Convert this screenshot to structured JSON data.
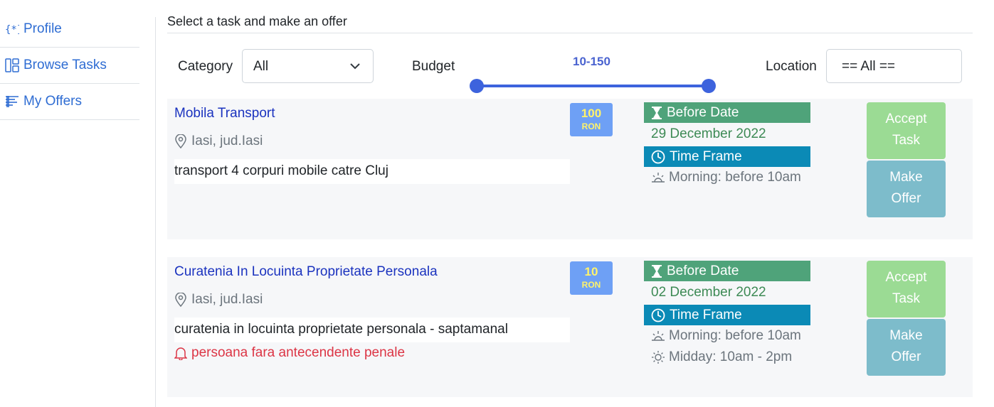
{
  "sidebar": {
    "items": [
      {
        "label": "Profile",
        "icon": "braces-asterisk-icon"
      },
      {
        "label": "Browse Tasks",
        "icon": "layout-icon"
      },
      {
        "label": "My Offers",
        "icon": "text-paragraph-icon"
      }
    ]
  },
  "main": {
    "heading": "Select a task and make an offer"
  },
  "filters": {
    "category_label": "Category",
    "category_value": "All",
    "budget_label": "Budget",
    "budget_range": "10-150",
    "location_label": "Location",
    "location_value": "== All =="
  },
  "tasks": [
    {
      "title": "Mobila Transport",
      "location": "Iasi, jud.Iasi",
      "description": "transport 4 corpuri mobile catre Cluj",
      "note": "",
      "price": "100",
      "currency": "RON",
      "before_date_label": "Before Date",
      "before_date": "29 December 2022",
      "time_frame_label": "Time Frame",
      "time_frames": [
        "Morning: before 10am"
      ],
      "accept_label_1": "Accept",
      "accept_label_2": "Task",
      "offer_label_1": "Make",
      "offer_label_2": "Offer"
    },
    {
      "title": "Curatenia In Locuinta Proprietate Personala",
      "location": "Iasi, jud.Iasi",
      "description": "curatenia in locuinta proprietate personala - saptamanal",
      "note": "persoana fara antecendente penale",
      "price": "10",
      "currency": "RON",
      "before_date_label": "Before Date",
      "before_date": "02 December 2022",
      "time_frame_label": "Time Frame",
      "time_frames": [
        "Morning: before 10am",
        "Midday: 10am - 2pm"
      ],
      "accept_label_1": "Accept",
      "accept_label_2": "Task",
      "offer_label_1": "Make",
      "offer_label_2": "Offer"
    }
  ],
  "colors": {
    "link": "#2f6dd3",
    "title": "#1b33bf",
    "price_bg": "#6ea0f5",
    "before_date_bar": "#4fa37a",
    "time_frame_bar": "#0b8ab6",
    "accept_button": "#9bdb94",
    "offer_button": "#7dbccb",
    "note": "#dc3545"
  }
}
